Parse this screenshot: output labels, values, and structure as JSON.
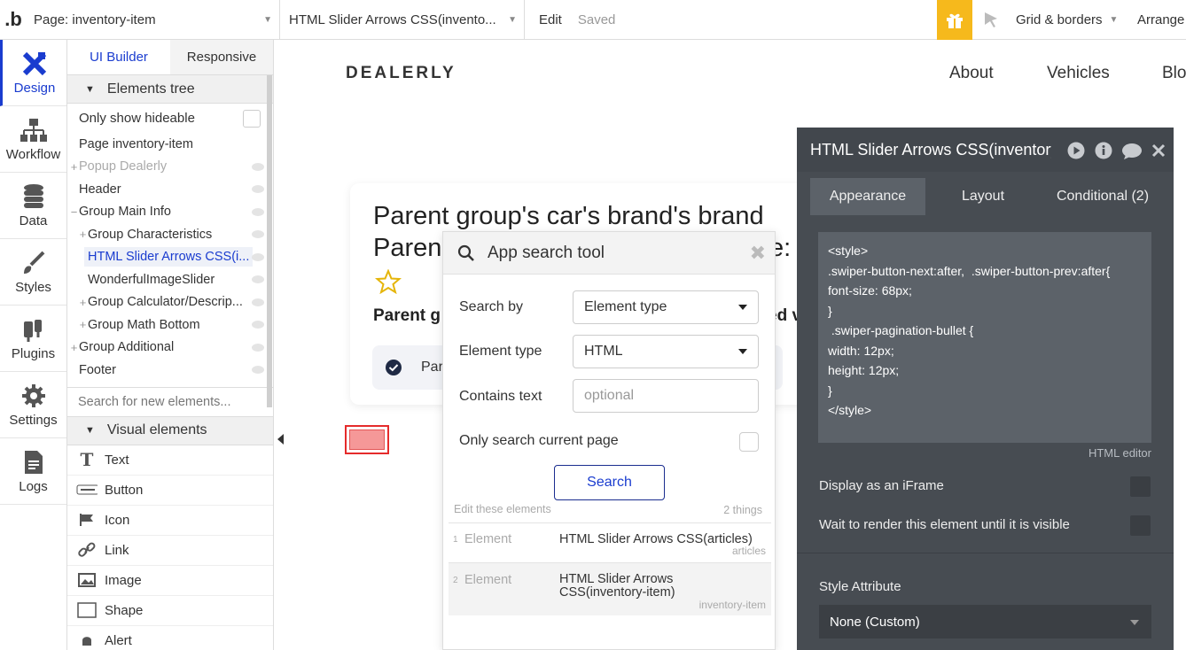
{
  "topbar": {
    "logo": ".b",
    "page_label": "Page: inventory-item",
    "element_label": "HTML Slider Arrows CSS(invento...",
    "edit": "Edit",
    "saved": "Saved",
    "grid": "Grid & borders",
    "arrange": "Arrange"
  },
  "leftnav": {
    "items": [
      {
        "label": "Design",
        "icon": "design-icon"
      },
      {
        "label": "Workflow",
        "icon": "workflow-icon"
      },
      {
        "label": "Data",
        "icon": "database-icon"
      },
      {
        "label": "Styles",
        "icon": "brush-icon"
      },
      {
        "label": "Plugins",
        "icon": "plug-icon"
      },
      {
        "label": "Settings",
        "icon": "gear-icon"
      },
      {
        "label": "Logs",
        "icon": "document-icon"
      }
    ]
  },
  "panel": {
    "tab_ui": "UI Builder",
    "tab_responsive": "Responsive",
    "elements_tree": "Elements tree",
    "only_hideable": "Only show hideable",
    "tree": [
      "Page inventory-item",
      "Popup Dealerly",
      "Header",
      "Group Main Info",
      "Group Characteristics",
      "HTML Slider Arrows CSS(i...",
      "WonderfulImageSlider",
      "Group Calculator/Descrip...",
      "Group Math Bottom",
      "Group Additional",
      "Footer"
    ],
    "search_placeholder": "Search for new elements...",
    "visual_elements": "Visual elements",
    "visual": [
      "Text",
      "Button",
      "Icon",
      "Link",
      "Image",
      "Shape",
      "Alert"
    ]
  },
  "canvas": {
    "brand": "DEALERLY",
    "nav": [
      "About",
      "Vehicles",
      "Blo"
    ],
    "title1": "Parent group's car's brand's brand",
    "title2": "Paren",
    "title2_end": "e:",
    "sub": "Parent g",
    "sub_end": "ed v",
    "feature": "Par"
  },
  "search_tool": {
    "title": "App search tool",
    "search_by_label": "Search by",
    "search_by_value": "Element type",
    "element_type_label": "Element type",
    "element_type_value": "HTML",
    "contains_label": "Contains text",
    "contains_placeholder": "optional",
    "only_current": "Only search current page",
    "search_button": "Search",
    "edit_these": "Edit these elements",
    "count": "2 things",
    "results": [
      {
        "num": "1",
        "type": "Element",
        "name": "HTML Slider Arrows CSS(articles)",
        "page": "articles"
      },
      {
        "num": "2",
        "type": "Element",
        "name": "HTML Slider Arrows CSS(inventory-item)",
        "page": "inventory-item"
      }
    ]
  },
  "property_editor": {
    "title": "HTML Slider Arrows CSS(inventory-item)",
    "tabs": [
      "Appearance",
      "Layout",
      "Conditional (2)"
    ],
    "html": "<style>\n.swiper-button-next:after,  .swiper-button-prev:after{\nfont-size: 68px;\n}\n .swiper-pagination-bullet {\nwidth: 12px;\nheight: 12px;\n}\n</style>",
    "html_editor": "HTML editor",
    "iframe": "Display as an iFrame",
    "wait_render": "Wait to render this element until it is visible",
    "style_attr": "Style Attribute",
    "style_value": "None (Custom)"
  },
  "colors": {
    "accent": "#1a3ccf",
    "gift": "#f6b91c",
    "editor_bg": "#474c52"
  }
}
